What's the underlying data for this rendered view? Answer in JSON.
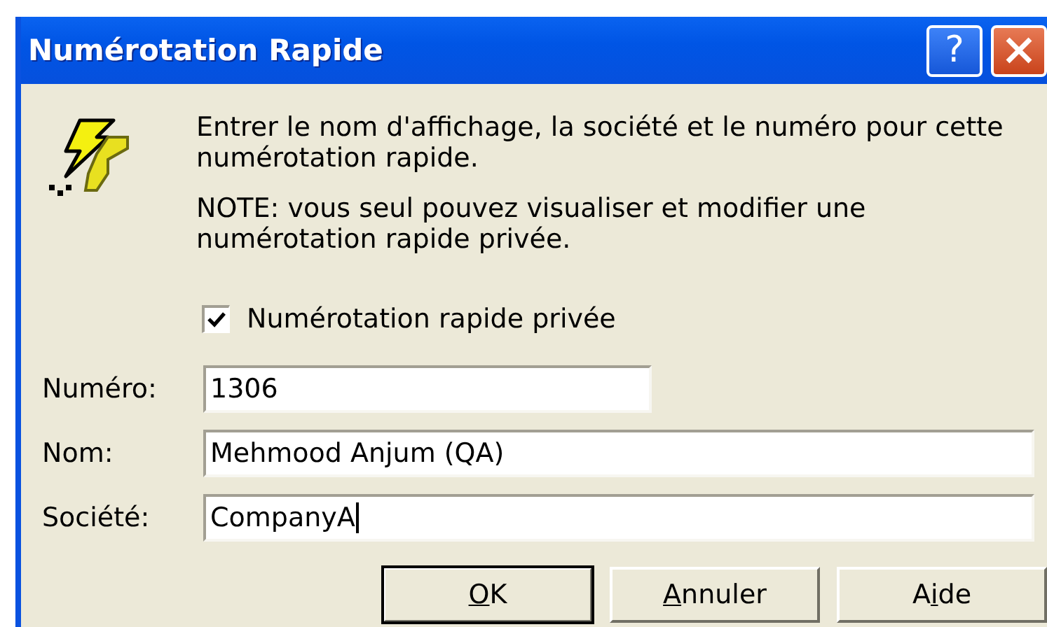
{
  "window": {
    "title": "Numérotation Rapide",
    "title_buttons": [
      {
        "kind": "help",
        "label": "?"
      },
      {
        "kind": "close"
      }
    ]
  },
  "intro": "Entrer le nom d'affichage, la société et le numéro pour cette numérotation rapide.",
  "note": "NOTE: vous seul pouvez visualiser et modifier une numérotation rapide privée.",
  "private_checkbox": {
    "label": "Numérotation rapide privée",
    "checked": true
  },
  "fields": [
    {
      "label": "Numéro:",
      "value": "1306",
      "kind": "short",
      "focused": false
    },
    {
      "label": "Nom:",
      "value": "Mehmood Anjum (QA)",
      "kind": "wide",
      "focused": false
    },
    {
      "label": "Société:",
      "value": "CompanyA",
      "kind": "wide",
      "focused": true
    }
  ],
  "buttons": [
    {
      "key": "O",
      "after": "K",
      "default": true
    },
    {
      "key": "A",
      "after": "nnuler",
      "default": false
    },
    {
      "before": "A",
      "key": "i",
      "after": "de",
      "default": false
    }
  ]
}
